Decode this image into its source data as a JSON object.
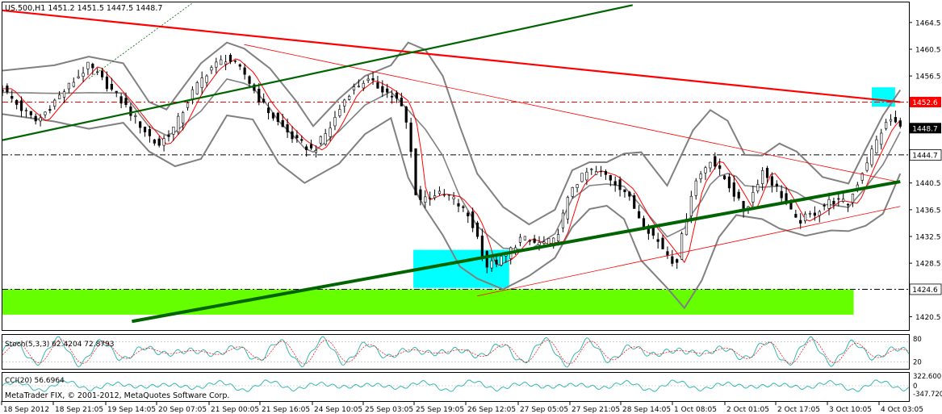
{
  "header": {
    "symbol_line": "US.500,H1  1451.2 1451.5 1447.5 1448.7"
  },
  "footer": {
    "copyright": "MetaTrader FIX, © 2001-2012, MetaQuotes Software Corp."
  },
  "colors": {
    "candle": "#000000",
    "bollinger": "#808080",
    "ma": "#ff0000",
    "resistance": "#ff0000",
    "uptrend": "#006400",
    "support_zone": "#66ff00",
    "highlight_zone": "#00ffff",
    "stoch_main": "#20b2aa",
    "stoch_signal": "#ff0000",
    "cci": "#20b2aa"
  },
  "chart_data": [
    {
      "type": "candlestick",
      "symbol": "US.500",
      "timeframe": "H1",
      "ohlc_last": {
        "open": 1451.2,
        "high": 1451.5,
        "low": 1447.5,
        "close": 1448.7
      },
      "ylim": [
        1418.5,
        1467.5
      ],
      "y_ticks": [
        1464.5,
        1460.5,
        1456.5,
        1452.5,
        1448.5,
        1444.5,
        1440.5,
        1436.5,
        1432.5,
        1428.5,
        1424.5,
        1420.5
      ],
      "price_labels": [
        {
          "value": 1452.6,
          "text": "1452.6",
          "style": "red"
        },
        {
          "value": 1448.7,
          "text": "1448.7",
          "style": "black"
        },
        {
          "value": 1444.7,
          "text": "1444.7",
          "style": "white"
        },
        {
          "value": 1424.6,
          "text": "1424.6",
          "style": "white"
        }
      ],
      "x_labels": [
        "18 Sep 2012",
        "18 Sep 21:05",
        "19 Sep 14:05",
        "20 Sep 07:05",
        "21 Sep 00:05",
        "21 Sep 16:05",
        "24 Sep 10:05",
        "25 Sep 03:05",
        "25 Sep 19:05",
        "26 Sep 12:05",
        "27 Sep 05:05",
        "27 Sep 21:05",
        "28 Sep 14:05",
        "1 Oct 08:05",
        "2 Oct 01:05",
        "2 Oct 17:05",
        "3 Oct 10:05",
        "4 Oct 03:05"
      ],
      "close_path": [
        [
          0,
          1454.6
        ],
        [
          2,
          1451.8
        ],
        [
          4,
          1449.6
        ],
        [
          6,
          1452.7
        ],
        [
          8,
          1455.4
        ],
        [
          10,
          1458.1
        ],
        [
          12,
          1455.3
        ],
        [
          14,
          1452.4
        ],
        [
          16,
          1449.1
        ],
        [
          18,
          1446.0
        ],
        [
          20,
          1449.0
        ],
        [
          22,
          1454.1
        ],
        [
          24,
          1457.6
        ],
        [
          26,
          1459.2
        ],
        [
          28,
          1456.9
        ],
        [
          30,
          1452.5
        ],
        [
          32,
          1449.4
        ],
        [
          34,
          1446.8
        ],
        [
          36,
          1445.3
        ],
        [
          38,
          1448.9
        ],
        [
          40,
          1453.9
        ],
        [
          42,
          1455.9
        ],
        [
          44,
          1454.6
        ],
        [
          46,
          1452.6
        ],
        [
          47,
          1448.5
        ],
        [
          48,
          1437.8
        ],
        [
          50,
          1438.9
        ],
        [
          52,
          1438.4
        ],
        [
          54,
          1435.5
        ],
        [
          55,
          1432.5
        ],
        [
          56,
          1428.0
        ],
        [
          58,
          1429.2
        ],
        [
          60,
          1432.2
        ],
        [
          62,
          1431.4
        ],
        [
          64,
          1431.8
        ],
        [
          66,
          1440.0
        ],
        [
          68,
          1442.4
        ],
        [
          70,
          1441.6
        ],
        [
          72,
          1439.5
        ],
        [
          74,
          1434.9
        ],
        [
          76,
          1431.6
        ],
        [
          78,
          1428.3
        ],
        [
          80,
          1440.1
        ],
        [
          82,
          1444.1
        ],
        [
          84,
          1440.5
        ],
        [
          86,
          1436.1
        ],
        [
          88,
          1442.4
        ],
        [
          90,
          1439.2
        ],
        [
          92,
          1434.6
        ],
        [
          94,
          1436.0
        ],
        [
          96,
          1437.9
        ],
        [
          98,
          1437.4
        ],
        [
          100,
          1443.4
        ],
        [
          102,
          1448.8
        ],
        [
          103,
          1450.1
        ],
        [
          104,
          1448.7
        ]
      ],
      "bollinger_upper": [
        [
          0,
          1457.3
        ],
        [
          6,
          1458.1
        ],
        [
          10,
          1459.4
        ],
        [
          14,
          1458.4
        ],
        [
          17,
          1452.6
        ],
        [
          19,
          1451.5
        ],
        [
          23,
          1458.4
        ],
        [
          26,
          1461.5
        ],
        [
          28,
          1460.6
        ],
        [
          31,
          1457.6
        ],
        [
          34,
          1452.8
        ],
        [
          36,
          1449.0
        ],
        [
          39,
          1453.1
        ],
        [
          42,
          1456.5
        ],
        [
          45,
          1458.1
        ],
        [
          47,
          1461.5
        ],
        [
          49,
          1460.4
        ],
        [
          51,
          1456.5
        ],
        [
          53,
          1448.9
        ],
        [
          55,
          1441.9
        ],
        [
          58,
          1436.9
        ],
        [
          61,
          1434.3
        ],
        [
          64,
          1436.5
        ],
        [
          66,
          1442.4
        ],
        [
          68,
          1443.6
        ],
        [
          70,
          1443.6
        ],
        [
          72,
          1444.9
        ],
        [
          74,
          1445.1
        ],
        [
          77,
          1440.1
        ],
        [
          80,
          1448.4
        ],
        [
          82,
          1451.4
        ],
        [
          84,
          1449.8
        ],
        [
          86,
          1444.7
        ],
        [
          88,
          1444.6
        ],
        [
          90,
          1446.4
        ],
        [
          92,
          1445.2
        ],
        [
          95,
          1441.4
        ],
        [
          98,
          1440.4
        ],
        [
          100,
          1445.6
        ],
        [
          102,
          1450.6
        ],
        [
          104,
          1454.4
        ]
      ],
      "bollinger_lower": [
        [
          0,
          1450.8
        ],
        [
          6,
          1449.7
        ],
        [
          10,
          1448.6
        ],
        [
          14,
          1449.5
        ],
        [
          17,
          1445.2
        ],
        [
          20,
          1443.0
        ],
        [
          23,
          1444.1
        ],
        [
          26,
          1450.6
        ],
        [
          29,
          1450.0
        ],
        [
          32,
          1443.5
        ],
        [
          35,
          1440.5
        ],
        [
          39,
          1443.4
        ],
        [
          42,
          1447.8
        ],
        [
          45,
          1450.2
        ],
        [
          47,
          1441.3
        ],
        [
          49,
          1436.6
        ],
        [
          51,
          1432.7
        ],
        [
          53,
          1428.0
        ],
        [
          55,
          1426.2
        ],
        [
          58,
          1424.6
        ],
        [
          61,
          1426.6
        ],
        [
          64,
          1429.3
        ],
        [
          66,
          1433.9
        ],
        [
          68,
          1436.6
        ],
        [
          70,
          1437.1
        ],
        [
          72,
          1435.1
        ],
        [
          74,
          1428.9
        ],
        [
          77,
          1424.8
        ],
        [
          79,
          1421.8
        ],
        [
          81,
          1425.9
        ],
        [
          83,
          1432.4
        ],
        [
          85,
          1435.7
        ],
        [
          88,
          1435.1
        ],
        [
          90,
          1433.7
        ],
        [
          93,
          1432.6
        ],
        [
          96,
          1433.4
        ],
        [
          98,
          1433.3
        ],
        [
          100,
          1434.1
        ],
        [
          102,
          1435.9
        ],
        [
          104,
          1441.9
        ]
      ],
      "trendlines": [
        {
          "name": "resistance",
          "from": [
            0,
            1466.3
          ],
          "to": [
            104,
            1452.6
          ],
          "style": "red-thick"
        },
        {
          "name": "falling-thin",
          "from": [
            28,
            1461.2
          ],
          "to": [
            104,
            1440.6
          ],
          "style": "red-thin"
        },
        {
          "name": "rising-thin",
          "from": [
            55,
            1423.6
          ],
          "to": [
            104,
            1437.0
          ],
          "style": "red-thin"
        },
        {
          "name": "main-uptrend",
          "from": [
            15,
            1419.8
          ],
          "to": [
            104,
            1440.7
          ],
          "style": "green-thick"
        },
        {
          "name": "steep-uptrend",
          "from": [
            0,
            1446.9
          ],
          "to": [
            73,
            1467.1
          ],
          "style": "green-medium"
        },
        {
          "name": "dotted-projection",
          "from": [
            10,
            1456.1
          ],
          "to": [
            22,
            1467.4
          ],
          "style": "green-dotted"
        }
      ],
      "horizontal_levels": [
        {
          "value": 1452.6,
          "style": "red-dashdot"
        },
        {
          "value": 1444.7,
          "style": "black-dashdot"
        },
        {
          "value": 1424.6,
          "style": "black-dashdot-short"
        }
      ],
      "zones": [
        {
          "x": [
            0,
            98.6
          ],
          "y": [
            1420.8,
            1424.6
          ],
          "color": "support_zone"
        },
        {
          "x": [
            47.6,
            58.7
          ],
          "y": [
            1424.8,
            1430.5
          ],
          "color": "highlight_zone"
        },
        {
          "x": [
            100.7,
            103.4
          ],
          "y": [
            1451.9,
            1454.8
          ],
          "color": "highlight_zone"
        }
      ]
    },
    {
      "type": "line",
      "indicator": "Stochastic",
      "label": "Stoch(5,3,3) 62.4204 72.8793",
      "ylim": [
        0,
        100
      ],
      "y_ticks": [
        "80",
        "20"
      ],
      "levels": [
        80,
        20
      ]
    },
    {
      "type": "line",
      "indicator": "CCI",
      "label": "CCI(20) 56.6964",
      "y_ticks": [
        "322.600",
        "0",
        "-347.720"
      ]
    }
  ]
}
